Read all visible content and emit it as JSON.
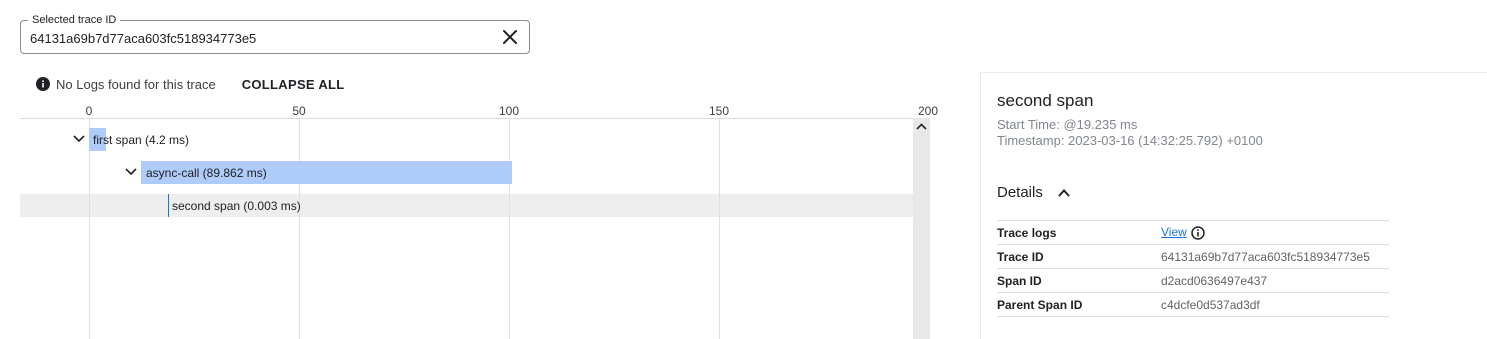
{
  "trace_field": {
    "label": "Selected trace ID",
    "value": "64131a69b7d77aca603fc518934773e5"
  },
  "toolbar": {
    "no_logs_text": "No Logs found for this trace",
    "collapse_label": "COLLAPSE ALL"
  },
  "timeline": {
    "ticks": [
      "0",
      "50",
      "100",
      "150",
      "200"
    ],
    "spans": [
      {
        "label": "first span (4.2 ms)",
        "start_ms": 0,
        "duration_ms": 4.2
      },
      {
        "label": "async-call (89.862 ms)",
        "start_ms": 12.5,
        "duration_ms": 89.862
      },
      {
        "label": "second span (0.003 ms)",
        "start_ms": 19.235,
        "duration_ms": 0.003
      }
    ]
  },
  "details": {
    "span_name": "second span",
    "start_time": "Start Time: @19.235 ms",
    "timestamp": "Timestamp: 2023-03-16 (14:32:25.792) +0100",
    "section_label": "Details",
    "rows": [
      {
        "key": "Trace logs",
        "value": "View"
      },
      {
        "key": "Trace ID",
        "value": "64131a69b7d77aca603fc518934773e5"
      },
      {
        "key": "Span ID",
        "value": "d2acd0636497e437"
      },
      {
        "key": "Parent Span ID",
        "value": "c4dcfe0d537ad3df"
      }
    ]
  },
  "colors": {
    "bar": "#aecbfa",
    "link": "#1a73e8",
    "highlight": "#eeeeee"
  }
}
